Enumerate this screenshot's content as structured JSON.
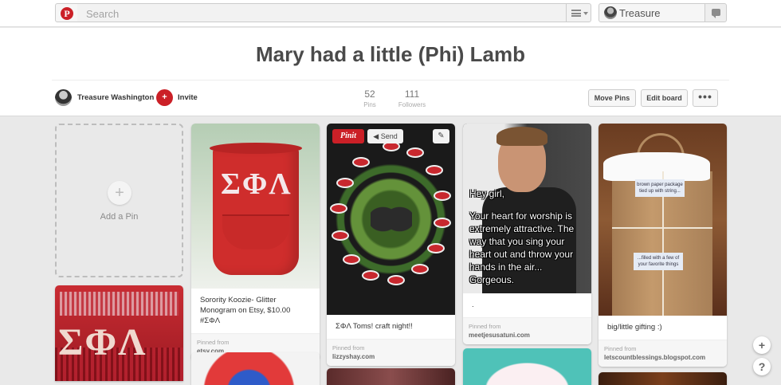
{
  "topbar": {
    "logo_letter": "P",
    "search_placeholder": "Search",
    "user_name": "Treasure"
  },
  "board": {
    "title": "Mary had a little (Phi) Lamb",
    "owner_name": "Treasure Washington",
    "invite_label": "Invite",
    "pins_count": "52",
    "pins_label": "Pins",
    "followers_count": "111",
    "followers_label": "Followers",
    "move_pins_label": "Move Pins",
    "edit_board_label": "Edit board",
    "more_label": "•••"
  },
  "add_pin": {
    "plus": "+",
    "label": "Add a Pin"
  },
  "pin_actions": {
    "pinit_label": "Pinit",
    "send_label": "◀ Send",
    "edit_symbol": "✎"
  },
  "pins": [
    {
      "image_text": "ΣΦΛ",
      "description": "Sorority Koozie- Glitter Monogram on Etsy, $10.00 #ΣΦΛ",
      "pinned_from_label": "Pinned from",
      "source": "etsy.com"
    },
    {
      "description": "ΣΦΛ Toms! craft night!!",
      "pinned_from_label": "Pinned from",
      "source": "lizzyshay.com"
    },
    {
      "meme_hey": "Hey girl,",
      "meme_body": "Your heart for worship is extremely attractive. The way that you sing your heart out and throw your hands in the air... Gorgeous.",
      "description": ".",
      "pinned_from_label": "Pinned from",
      "source": "meetjesusatuni.com"
    },
    {
      "tag_top": "brown paper package tied up with string...",
      "tag_bottom": "...filled with a few of your favorite things",
      "description": "big/little gifting :)",
      "pinned_from_label": "Pinned from",
      "source": "letscountblessings.blogspot.com"
    },
    {
      "image_text": "ΣΦΛ"
    }
  ],
  "floating": {
    "add": "+",
    "help": "?"
  },
  "colors": {
    "brand_red": "#cb2027",
    "background": "#e9e9e9"
  }
}
